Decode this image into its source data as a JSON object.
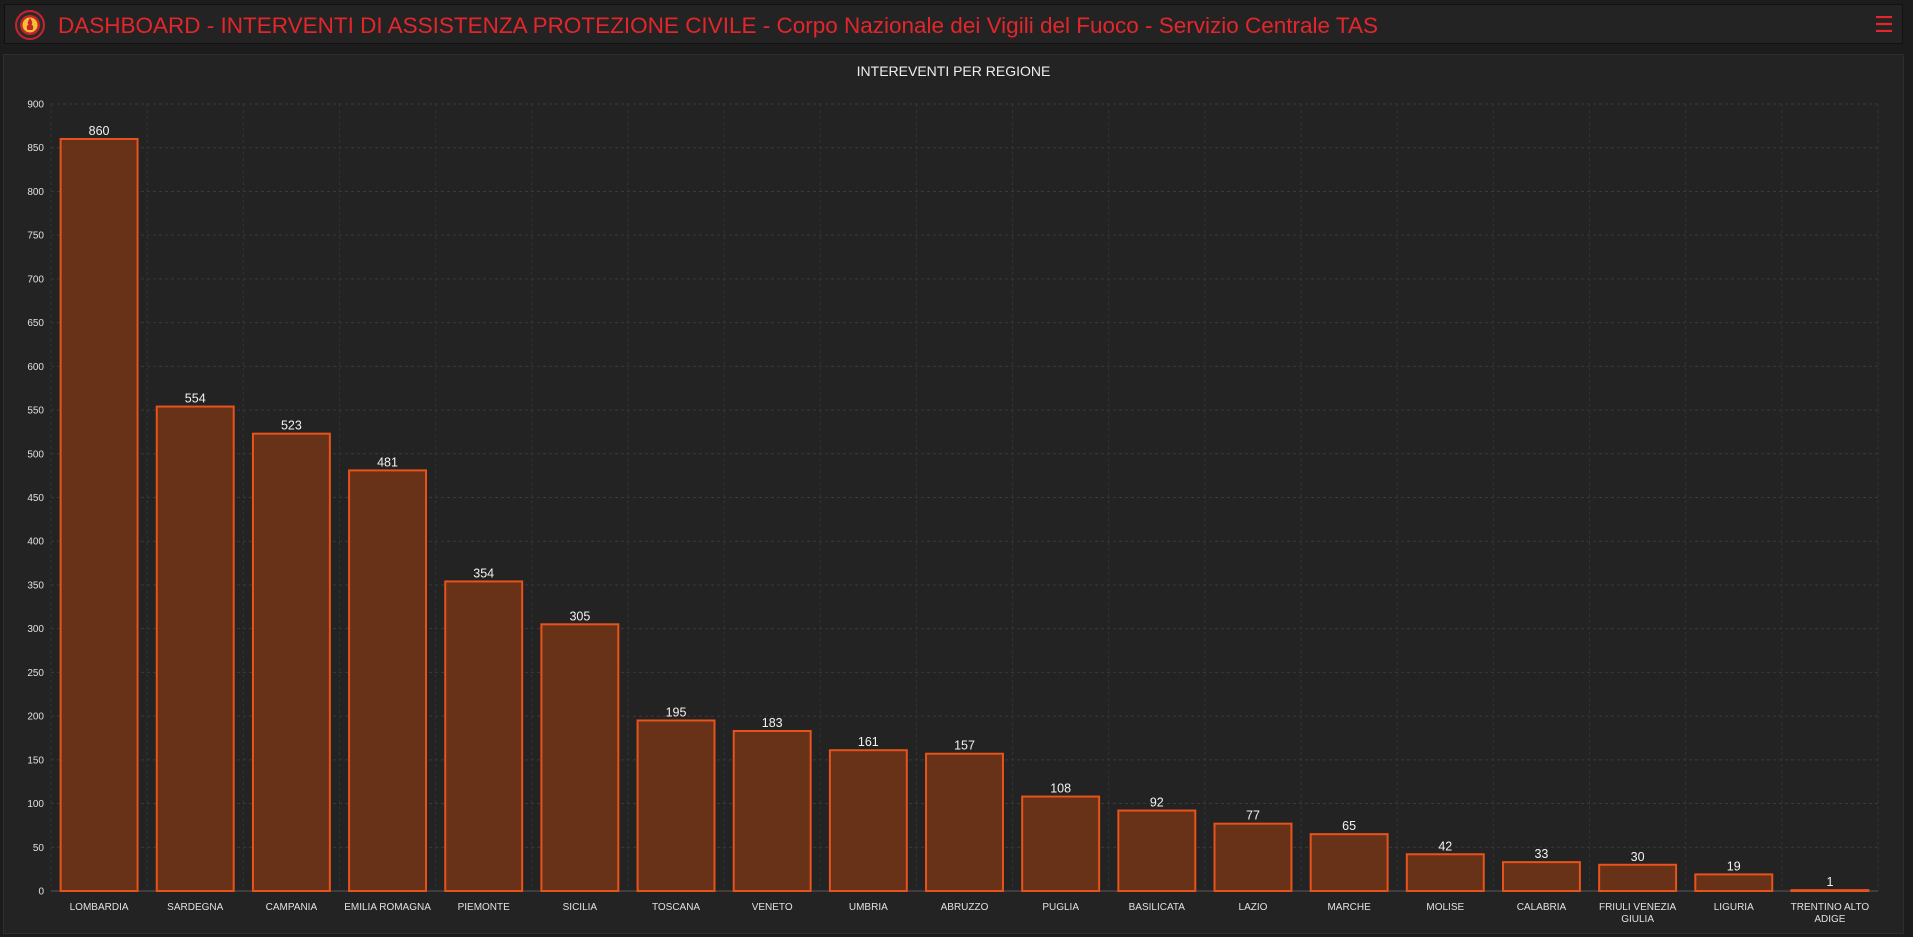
{
  "header": {
    "title": "DASHBOARD - INTERVENTI DI ASSISTENZA PROTEZIONE CIVILE - Corpo Nazionale dei Vigili del Fuoco - Servizio Centrale TAS",
    "menu_icon": "hamburger-menu-icon",
    "logo_icon": "fire-brigade-emblem-icon",
    "accent_color": "#e3262b"
  },
  "chart_data": {
    "type": "bar",
    "title": "INTEREVENTI PER REGIONE",
    "xlabel": "",
    "ylabel": "",
    "ylim": [
      0,
      900
    ],
    "yticks": [
      0,
      50,
      100,
      150,
      200,
      250,
      300,
      350,
      400,
      450,
      500,
      550,
      600,
      650,
      700,
      750,
      800,
      850,
      900
    ],
    "categories": [
      "LOMBARDIA",
      "SARDEGNA",
      "CAMPANIA",
      "EMILIA ROMAGNA",
      "PIEMONTE",
      "SICILIA",
      "TOSCANA",
      "VENETO",
      "UMBRIA",
      "ABRUZZO",
      "PUGLIA",
      "BASILICATA",
      "LAZIO",
      "MARCHE",
      "MOLISE",
      "CALABRIA",
      "FRIULI VENEZIA GIULIA",
      "LIGURIA",
      "TRENTINO ALTO ADIGE"
    ],
    "values": [
      860,
      554,
      523,
      481,
      354,
      305,
      195,
      183,
      161,
      157,
      108,
      92,
      77,
      65,
      42,
      33,
      30,
      19,
      1
    ],
    "grid": true,
    "bar_fill": "#673217",
    "bar_stroke": "#e8531c"
  }
}
